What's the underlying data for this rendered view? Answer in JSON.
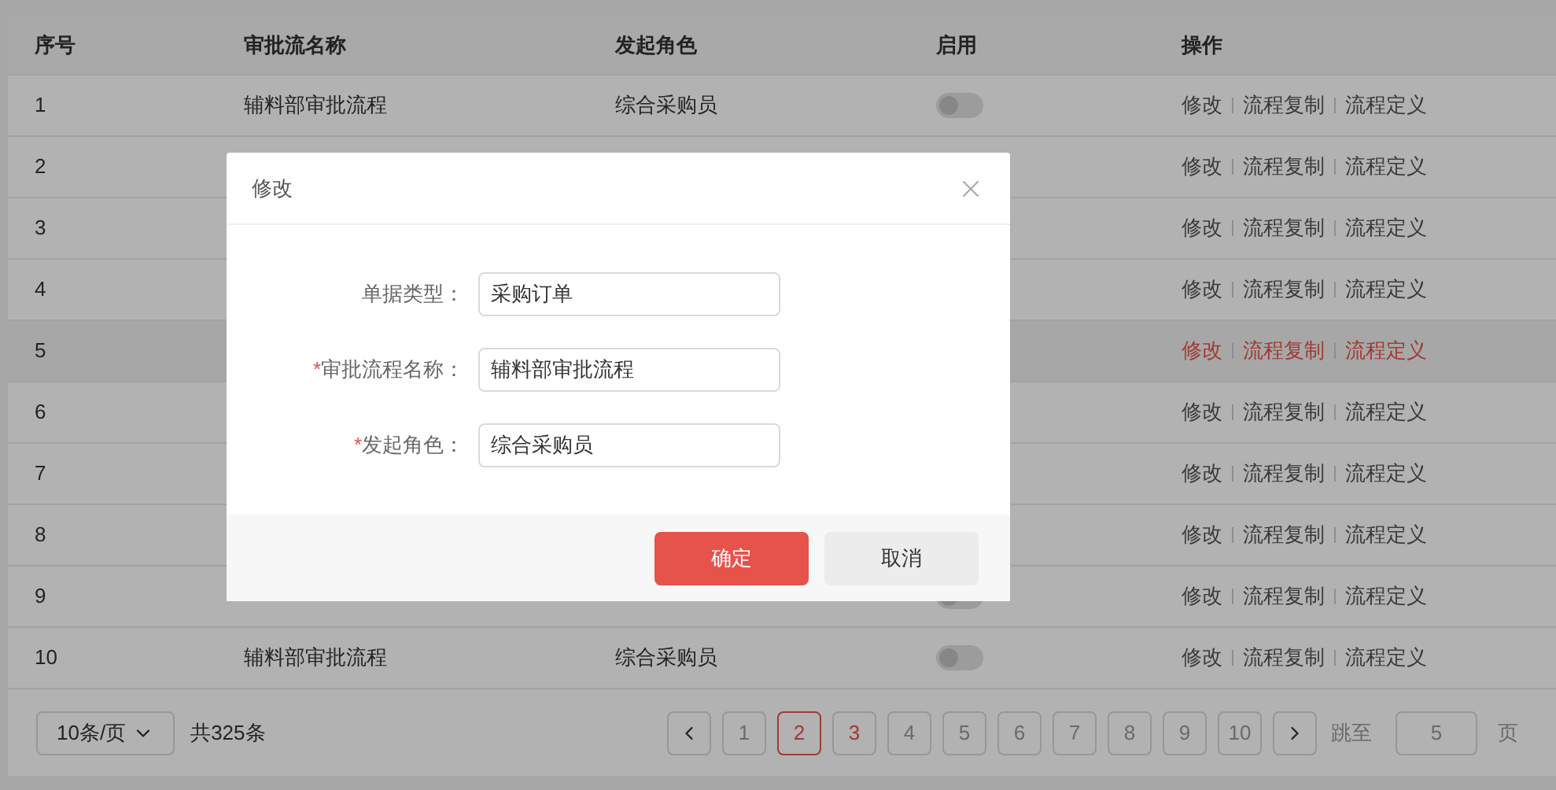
{
  "table": {
    "columns": [
      "序号",
      "审批流名称",
      "发起角色",
      "启用",
      "操作"
    ],
    "rows": [
      {
        "index": "1",
        "name": "辅料部审批流程",
        "role": "综合采购员",
        "enabled": {
          "on": false
        },
        "highlighted": false,
        "actions": [
          "修改",
          "流程复制",
          "流程定义"
        ]
      },
      {
        "index": "2",
        "highlighted": false,
        "actions": [
          "修改",
          "流程复制",
          "流程定义"
        ]
      },
      {
        "index": "3",
        "highlighted": false,
        "actions": [
          "修改",
          "流程复制",
          "流程定义"
        ]
      },
      {
        "index": "4",
        "highlighted": false,
        "actions": [
          "修改",
          "流程复制",
          "流程定义"
        ]
      },
      {
        "index": "5",
        "highlighted": true,
        "actions": [
          "修改",
          "流程复制",
          "流程定义"
        ]
      },
      {
        "index": "6",
        "highlighted": false,
        "actions": [
          "修改",
          "流程复制",
          "流程定义"
        ]
      },
      {
        "index": "7",
        "highlighted": false,
        "actions": [
          "修改",
          "流程复制",
          "流程定义"
        ]
      },
      {
        "index": "8",
        "highlighted": false,
        "actions": [
          "修改",
          "流程复制",
          "流程定义"
        ]
      },
      {
        "index": "9",
        "enabled": {
          "on": false
        },
        "highlighted": false,
        "actions": [
          "修改",
          "流程复制",
          "流程定义"
        ]
      },
      {
        "index": "10",
        "name": "辅料部审批流程",
        "role": "综合采购员",
        "enabled": {
          "on": false
        },
        "highlighted": false,
        "actions": [
          "修改",
          "流程复制",
          "流程定义"
        ]
      }
    ]
  },
  "pagination": {
    "page_size": "10条/页",
    "total": "共325条",
    "pages": [
      {
        "label": "1",
        "selected": false,
        "highlighted": false
      },
      {
        "label": "2",
        "selected": true,
        "highlighted": false
      },
      {
        "label": "3",
        "selected": false,
        "highlighted": true
      },
      {
        "label": "4",
        "selected": false,
        "highlighted": false
      },
      {
        "label": "5",
        "selected": false,
        "highlighted": false
      },
      {
        "label": "6",
        "selected": false,
        "highlighted": false
      },
      {
        "label": "7",
        "selected": false,
        "highlighted": false
      },
      {
        "label": "8",
        "selected": false,
        "highlighted": false
      },
      {
        "label": "9",
        "selected": false,
        "highlighted": false
      },
      {
        "label": "10",
        "selected": false,
        "highlighted": false
      }
    ],
    "jump_label": "跳至",
    "jump_value": "5",
    "jump_suffix": "页"
  },
  "dialog": {
    "title": "修改",
    "fields": [
      {
        "label": "单据类型：",
        "value": "采购订单"
      },
      {
        "label": "审批流程名称：",
        "required_mark": "*",
        "value": "辅料部审批流程"
      },
      {
        "label": "发起角色：",
        "required_mark": "*",
        "value": "综合采购员"
      }
    ],
    "confirm": "确定",
    "cancel": "取消"
  }
}
